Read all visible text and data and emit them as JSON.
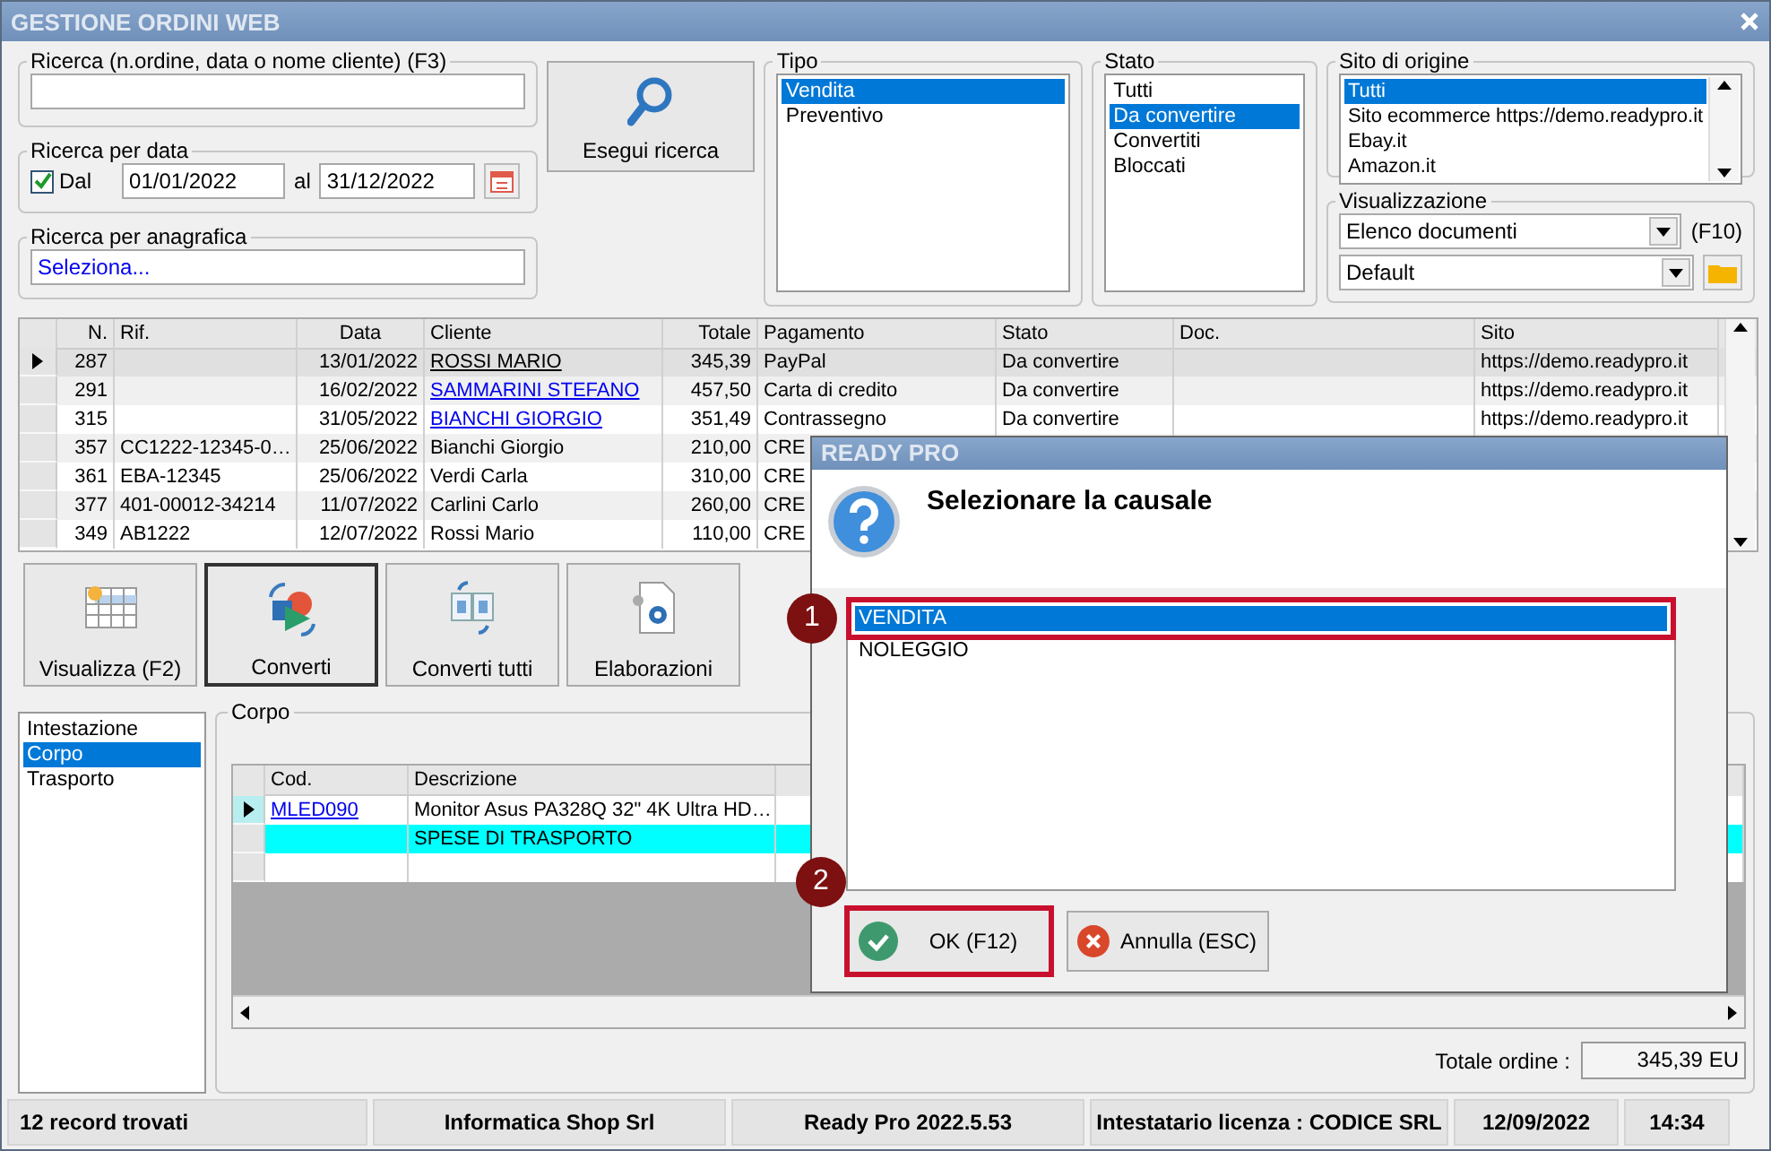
{
  "window": {
    "title": "GESTIONE ORDINI WEB"
  },
  "search": {
    "label": "Ricerca (n.ordine, data o nome cliente) (F3)"
  },
  "date_search": {
    "label": "Ricerca per data",
    "checkbox_label": "Dal",
    "checked": true,
    "from": "01/01/2022",
    "to_label": "al",
    "to": "31/12/2022"
  },
  "registry_search": {
    "label": "Ricerca per anagrafica",
    "value": "Seleziona..."
  },
  "search_button": {
    "label": "Esegui ricerca"
  },
  "tipo": {
    "label": "Tipo",
    "items": [
      {
        "label": "Vendita",
        "selected": true
      },
      {
        "label": "Preventivo",
        "selected": false
      }
    ]
  },
  "stato": {
    "label": "Stato",
    "items": [
      {
        "label": "Tutti",
        "selected": false
      },
      {
        "label": "Da convertire",
        "selected": true
      },
      {
        "label": "Convertiti",
        "selected": false
      },
      {
        "label": "Bloccati",
        "selected": false
      }
    ]
  },
  "sito": {
    "label": "Sito di origine",
    "items": [
      {
        "label": "Tutti",
        "selected": true
      },
      {
        "label": "Sito ecommerce https://demo.readypro.it",
        "selected": false
      },
      {
        "label": "Ebay.it",
        "selected": false
      },
      {
        "label": "Amazon.it",
        "selected": false
      }
    ]
  },
  "visualizzazione": {
    "label": "Visualizzazione",
    "view": "Elenco documenti",
    "shortcut": "(F10)",
    "layout": "Default"
  },
  "table": {
    "columns": [
      "N.",
      "Rif.",
      "Data",
      "Cliente",
      "Totale",
      "Pagamento",
      "Stato",
      "Doc.",
      "Sito"
    ],
    "rows": [
      {
        "selected": true,
        "link": true,
        "n": "287",
        "data": "13/01/2022",
        "cliente": "ROSSI MARIO",
        "totale": "345,39",
        "pagamento": "PayPal",
        "stato": "Da convertire",
        "sito": "https://demo.readypro.it"
      },
      {
        "selected": false,
        "link": true,
        "n": "291",
        "data": "16/02/2022",
        "cliente": "SAMMARINI STEFANO",
        "totale": "457,50",
        "pagamento": "Carta di credito",
        "stato": "Da convertire",
        "sito": "https://demo.readypro.it"
      },
      {
        "selected": false,
        "link": true,
        "n": "315",
        "data": "31/05/2022",
        "cliente": "BIANCHI GIORGIO",
        "totale": "351,49",
        "pagamento": "Contrassegno",
        "stato": "Da convertire",
        "sito": "https://demo.readypro.it"
      },
      {
        "selected": false,
        "link": false,
        "n": "357",
        "rif": "CC1222-12345-0…",
        "data": "25/06/2022",
        "cliente": "Bianchi Giorgio",
        "totale": "210,00",
        "pagamento": "CRE"
      },
      {
        "selected": false,
        "link": false,
        "n": "361",
        "rif": "EBA-12345",
        "data": "25/06/2022",
        "cliente": "Verdi Carla",
        "totale": "310,00",
        "pagamento": "CRE"
      },
      {
        "selected": false,
        "link": false,
        "n": "377",
        "rif": "401-00012-34214",
        "data": "11/07/2022",
        "cliente": "Carlini Carlo",
        "totale": "260,00",
        "pagamento": "CRE"
      },
      {
        "selected": false,
        "link": false,
        "n": "349",
        "rif": "AB1222",
        "data": "12/07/2022",
        "cliente": "Rossi Mario",
        "totale": "110,00",
        "pagamento": "CRE"
      }
    ]
  },
  "actions": [
    {
      "label": "Visualizza (F2)",
      "kind": "grid",
      "pressed": false
    },
    {
      "label": "Converti",
      "kind": "convert",
      "pressed": true
    },
    {
      "label": "Converti tutti",
      "kind": "copy",
      "pressed": false
    },
    {
      "label": "Elaborazioni",
      "kind": "process",
      "pressed": false
    }
  ],
  "sections": [
    {
      "label": "Intestazione",
      "selected": false
    },
    {
      "label": "Corpo",
      "selected": true
    },
    {
      "label": "Trasporto",
      "selected": false
    }
  ],
  "corpo": {
    "label": "Corpo",
    "columns": [
      "Cod.",
      "Descrizione"
    ],
    "rows": [
      {
        "current": true,
        "highlighted": false,
        "cod": "MLED090",
        "descrizione": "Monitor Asus PA328Q 32\" 4K Ultra HD…"
      },
      {
        "current": false,
        "highlighted": true,
        "descrizione": "SPESE DI TRASPORTO"
      },
      {
        "current": false,
        "highlighted": false
      }
    ],
    "total_label": "Totale ordine :",
    "total": "345,39 EU"
  },
  "status_bar": [
    "12 record trovati",
    "Informatica Shop Srl",
    "Ready Pro 2022.5.53",
    "Intestatario licenza : CODICE SRL",
    "12/09/2022",
    "14:34"
  ],
  "dialog": {
    "title": "READY PRO",
    "message": "Selezionare la causale",
    "items": [
      {
        "label": "VENDITA",
        "selected": true,
        "highlighted": true,
        "step": "1"
      },
      {
        "label": "NOLEGGIO",
        "selected": false,
        "highlighted": false
      }
    ],
    "buttons": [
      {
        "label": "OK (F12)",
        "kind": "ok",
        "highlighted": true,
        "step": "2"
      },
      {
        "label": "Annulla (ESC)",
        "kind": "cancel",
        "highlighted": false
      }
    ]
  }
}
